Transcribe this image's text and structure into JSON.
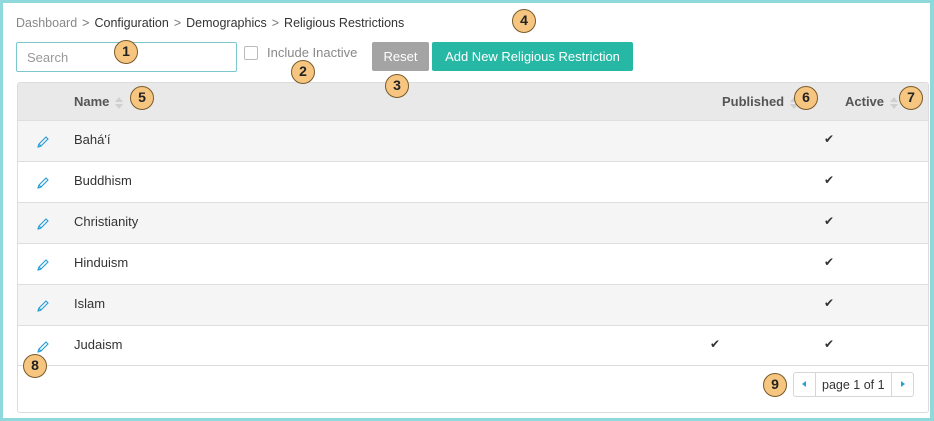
{
  "breadcrumb": {
    "items": [
      "Dashboard",
      "Configuration",
      "Demographics",
      "Religious Restrictions"
    ],
    "separator": ">"
  },
  "toolbar": {
    "search_placeholder": "Search",
    "search_value": "",
    "include_inactive_label": "Include Inactive",
    "include_inactive_checked": false,
    "reset_label": "Reset",
    "add_label": "Add New Religious Restriction"
  },
  "table": {
    "columns": {
      "name": "Name",
      "published": "Published",
      "active": "Active"
    },
    "rows": [
      {
        "name": "Bahá'í",
        "published": "",
        "active": "✔"
      },
      {
        "name": "Buddhism",
        "published": "",
        "active": "✔"
      },
      {
        "name": "Christianity",
        "published": "",
        "active": "✔"
      },
      {
        "name": "Hinduism",
        "published": "",
        "active": "✔"
      },
      {
        "name": "Islam",
        "published": "",
        "active": "✔"
      },
      {
        "name": "Judaism",
        "published": "✔",
        "active": "✔"
      }
    ]
  },
  "pager": {
    "label": "page 1 of 1"
  },
  "badges": [
    "1",
    "2",
    "3",
    "4",
    "5",
    "6",
    "7",
    "8",
    "9"
  ],
  "colors": {
    "accent": "#26b8a4",
    "reset": "#a4a4a4",
    "edit_icon": "#2a9fd6",
    "badge_fill": "#f6c580",
    "frame_border": "#8fd8dc"
  },
  "icons": {
    "edit": "pencil-icon",
    "sort": "sort-icon",
    "prev": "chevron-left-icon",
    "next": "chevron-right-icon"
  }
}
